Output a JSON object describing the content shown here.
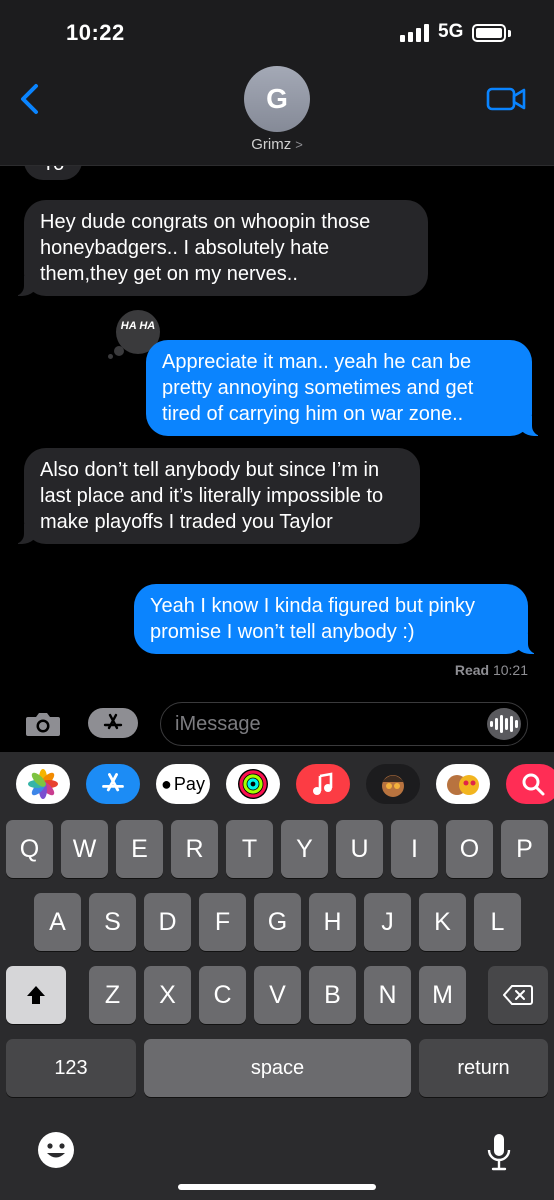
{
  "status": {
    "time": "10:22",
    "network": "5G"
  },
  "header": {
    "avatar_initial": "G",
    "contact_name": "Grimz",
    "chevron": ">"
  },
  "messages": {
    "partial": "Yo",
    "m1": "Hey dude congrats on whoopin those honeybadgers.. I absolutely hate them,they get on my nerves..",
    "reaction": "HA HA",
    "m2": "Appreciate it man.. yeah he can be pretty annoying sometimes and get tired of carrying him on war zone..",
    "m3": "Also don’t tell anybody but since I’m in last place and it’s literally impossible to make playoffs I traded you Taylor",
    "m4": "Yeah I know I kinda figured but pinky promise I won’t tell anybody :)",
    "read_label": "Read",
    "read_time": "10:21"
  },
  "input": {
    "placeholder": "iMessage"
  },
  "apps": {
    "apple_pay_label": "Pay",
    "icons": [
      "photos-icon",
      "app-store-icon",
      "apple-pay-icon",
      "fitness-icon",
      "music-icon",
      "memoji-icon",
      "memoji-stickers-icon",
      "images-search-icon"
    ]
  },
  "keyboard": {
    "row1": [
      "Q",
      "W",
      "E",
      "R",
      "T",
      "Y",
      "U",
      "I",
      "O",
      "P"
    ],
    "row2": [
      "A",
      "S",
      "D",
      "F",
      "G",
      "H",
      "J",
      "K",
      "L"
    ],
    "row3": [
      "Z",
      "X",
      "C",
      "V",
      "B",
      "N",
      "M"
    ],
    "numbers": "123",
    "space": "space",
    "return": "return"
  },
  "colors": {
    "outgoing": "#0b84fe",
    "incoming": "#262629",
    "accent": "#0a84ff"
  }
}
